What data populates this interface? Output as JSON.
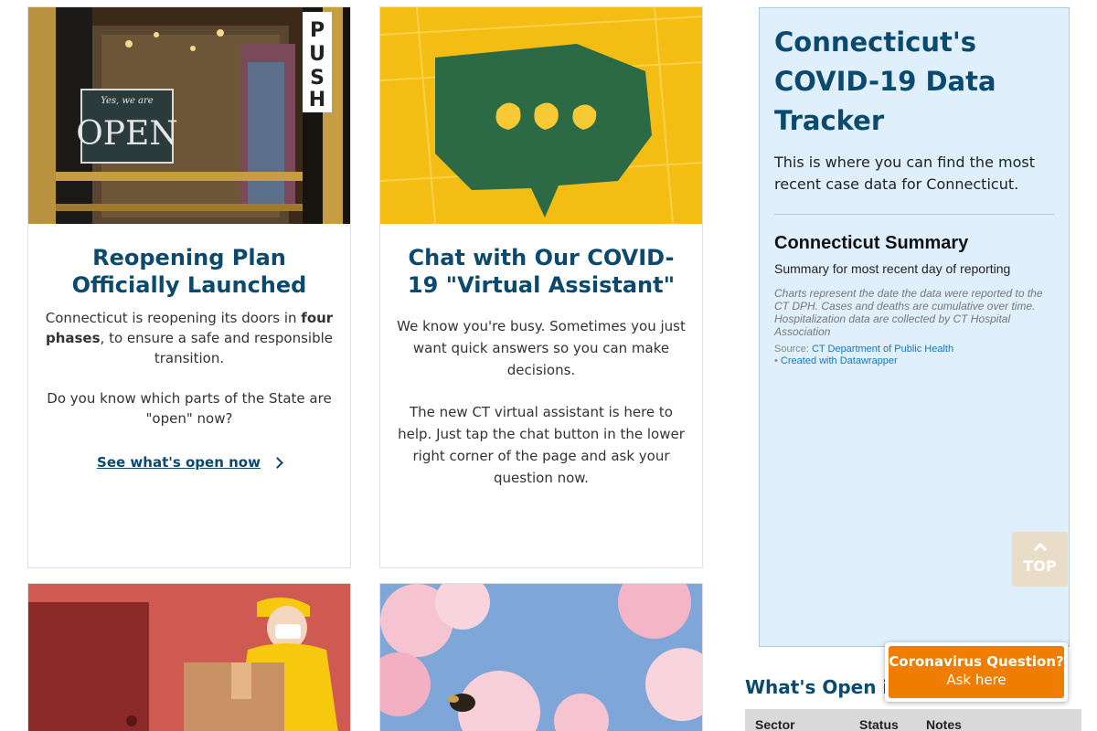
{
  "cards": [
    {
      "title": "Reopening Plan Officially Launched",
      "p1_pre": "Connecticut is reopening its doors in ",
      "p1_bold": "four phases",
      "p1_post": ", to ensure a safe and responsible transition.",
      "p2": "Do you know which parts of the State are \"open\" now?",
      "link": "See what's open now",
      "sign_text": "Yes, we are OPEN",
      "push_text": "PUSH"
    },
    {
      "title": "Chat with Our COVID-19 \"Virtual Assistant\"",
      "p1": "We know you're busy. Sometimes you just want quick answers so you can make decisions.",
      "p2": "The new CT virtual assistant is here to help. Just tap the chat button in the lower right corner of the page and ask your question now."
    }
  ],
  "tracker": {
    "title": "Connecticut's COVID-19 Data Tracker",
    "intro": "This is where you can find the most recent case data for Connecticut.",
    "summary_title": "Connecticut Summary",
    "summary_sub": "Summary for most recent day of reporting",
    "note": "Charts represent the date the data were reported to the CT DPH.  Cases and deaths are cumulative over time. Hospitalization data are collected by CT Hospital Association",
    "source_label": "Source:",
    "source_link": "CT Department of Public Health",
    "created_with": "Created with Datawrapper"
  },
  "top_button": {
    "label": "TOP"
  },
  "whats_open": {
    "heading": "What's Open in C",
    "columns": [
      "Sector",
      "Status",
      "Notes"
    ]
  },
  "chat": {
    "question": "Coronavirus Question?",
    "action": "Ask here"
  },
  "colors": {
    "heading_blue": "#0b4a6e",
    "tracker_bg": "#dff0fc",
    "chat_orange": "#ef7d00",
    "top_btn": "#e9ddc9"
  }
}
